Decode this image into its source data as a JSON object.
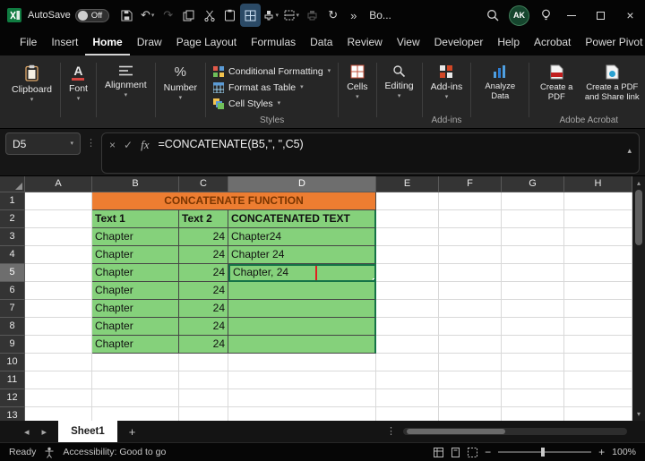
{
  "titlebar": {
    "autosave_label": "AutoSave",
    "autosave_state": "Off",
    "doc_name": "Bo...",
    "avatar_initials": "AK"
  },
  "menubar": {
    "items": [
      "File",
      "Insert",
      "Home",
      "Draw",
      "Page Layout",
      "Formulas",
      "Data",
      "Review",
      "View",
      "Developer",
      "Help",
      "Acrobat",
      "Power Pivot"
    ]
  },
  "ribbon": {
    "clipboard": "Clipboard",
    "font": "Font",
    "alignment": "Alignment",
    "number": "Number",
    "conditional_formatting": "Conditional Formatting",
    "format_as_table": "Format as Table",
    "cell_styles": "Cell Styles",
    "styles_group": "Styles",
    "cells": "Cells",
    "editing": "Editing",
    "addins_button": "Add-ins",
    "addins_group": "Add-ins",
    "analyze_data": "Analyze Data",
    "create_pdf": "Create a PDF",
    "create_pdf_share": "Create a PDF and Share link",
    "acrobat_group": "Adobe Acrobat"
  },
  "formula_bar": {
    "name_box": "D5",
    "formula": "=CONCATENATE(B5,\", \",C5)"
  },
  "grid": {
    "col_letters": [
      "A",
      "B",
      "C",
      "D",
      "E",
      "F",
      "G",
      "H"
    ],
    "row_numbers": [
      "1",
      "2",
      "3",
      "4",
      "5",
      "6",
      "7",
      "8",
      "9",
      "10",
      "11",
      "12",
      "13"
    ],
    "title": "CONCATENATE FUNCTION",
    "headers": {
      "text1": "Text 1",
      "text2": "Text 2",
      "result": "CONCATENATED TEXT"
    },
    "rows": [
      {
        "text1": "Chapter",
        "text2": "24",
        "result": "Chapter24"
      },
      {
        "text1": "Chapter",
        "text2": "24",
        "result": "Chapter 24"
      },
      {
        "text1": "Chapter",
        "text2": "24",
        "result": "Chapter, 24"
      },
      {
        "text1": "Chapter",
        "text2": "24",
        "result": ""
      },
      {
        "text1": "Chapter",
        "text2": "24",
        "result": ""
      },
      {
        "text1": "Chapter",
        "text2": "24",
        "result": ""
      },
      {
        "text1": "Chapter",
        "text2": "24",
        "result": ""
      }
    ]
  },
  "tabbar": {
    "sheet_name": "Sheet1"
  },
  "statusbar": {
    "ready": "Ready",
    "accessibility": "Accessibility: Good to go",
    "zoom": "100%"
  },
  "colors": {
    "table_green": "#85D17B",
    "header_orange": "#ED7D31",
    "selection_green": "#157347",
    "annotation_red": "#E02020",
    "excel_green": "#107C41"
  },
  "icons": {
    "chevron_down": "▾",
    "chevron_up": "▴",
    "overflow": "»",
    "ellipsis": "⋮",
    "undo": "↶",
    "redo": "↷",
    "sync": "↻",
    "cancel": "×",
    "enter": "✓",
    "fx": "fx",
    "tab_left": "◂",
    "tab_right": "▸",
    "plus": "+",
    "minus": "−",
    "close": "×",
    "scroll_up": "▴",
    "scroll_down": "▾"
  }
}
